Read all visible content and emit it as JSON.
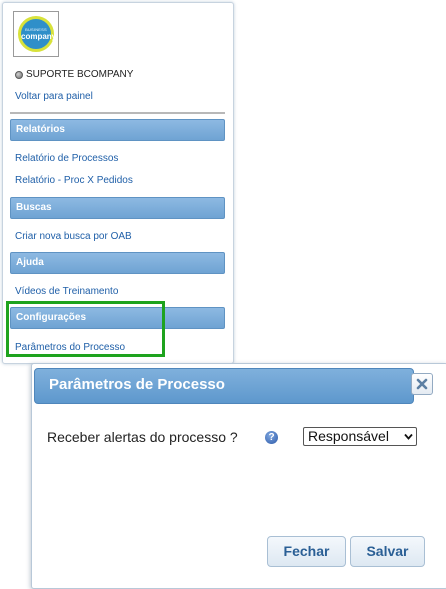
{
  "logo": {
    "small_text": "BUSINESS",
    "big_text": "company"
  },
  "sidebar": {
    "user_name": "SUPORTE BCOMPANY",
    "back_link": "Voltar para painel",
    "sections": [
      {
        "title": "Relatórios",
        "items": [
          "Relatório de Processos",
          "Relatório - Proc X Pedidos"
        ]
      },
      {
        "title": "Buscas",
        "items": [
          "Criar nova busca por OAB"
        ]
      },
      {
        "title": "Ajuda",
        "items": [
          "Vídeos de Treinamento"
        ]
      },
      {
        "title": "Configurações",
        "items": [
          "Parâmetros do Processo"
        ]
      }
    ]
  },
  "dialog": {
    "title": "Parâmetros de Processo",
    "alert_label": "Receber alertas do processo ?",
    "select_value": "Responsável",
    "close_label": "Fechar",
    "save_label": "Salvar"
  },
  "colors": {
    "header_blue": "#6fa3d3",
    "link_blue": "#1f5fa8",
    "highlight_green": "#1ea31e",
    "button_text": "#2a5f95"
  },
  "icons": [
    "status-dot-icon",
    "help-icon",
    "close-icon",
    "chevron-down-icon"
  ]
}
